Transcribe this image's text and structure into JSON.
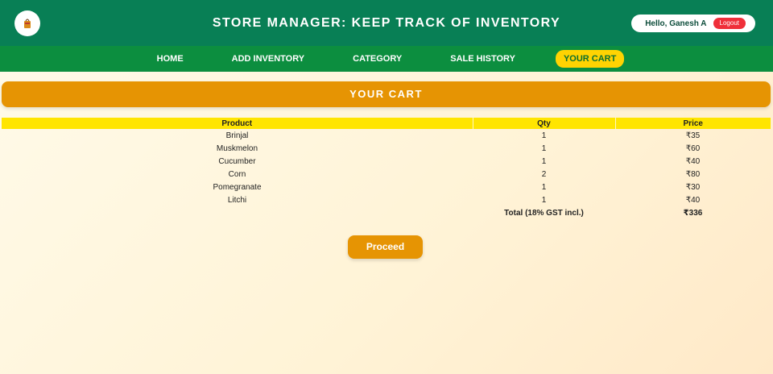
{
  "header": {
    "title": "STORE MANAGER: KEEP TRACK OF INVENTORY",
    "greeting": "Hello, Ganesh A",
    "logout_label": "Logout",
    "colors": {
      "header_bg": "#087f55",
      "nav_bg": "#0c8e3f",
      "accent": "#e69403",
      "highlight": "#ffd302",
      "logout": "#ef2f3a"
    }
  },
  "nav": {
    "items": [
      {
        "label": "HOME"
      },
      {
        "label": "ADD INVENTORY"
      },
      {
        "label": "CATEGORY"
      },
      {
        "label": "SALE HISTORY"
      },
      {
        "label": "YOUR CART",
        "active": true
      }
    ]
  },
  "banner": {
    "title": "YOUR CART"
  },
  "cart": {
    "headers": [
      "Product",
      "Qty",
      "Price"
    ],
    "rows": [
      {
        "product": "Brinjal",
        "qty": "1",
        "price": "₹35"
      },
      {
        "product": "Muskmelon",
        "qty": "1",
        "price": "₹60"
      },
      {
        "product": "Cucumber",
        "qty": "1",
        "price": "₹40"
      },
      {
        "product": "Corn",
        "qty": "2",
        "price": "₹80"
      },
      {
        "product": "Pomegranate",
        "qty": "1",
        "price": "₹30"
      },
      {
        "product": "Litchi",
        "qty": "1",
        "price": "₹40"
      }
    ],
    "total_label": "Total (18% GST incl.)",
    "total_value": "₹336"
  },
  "actions": {
    "proceed_label": "Proceed"
  }
}
